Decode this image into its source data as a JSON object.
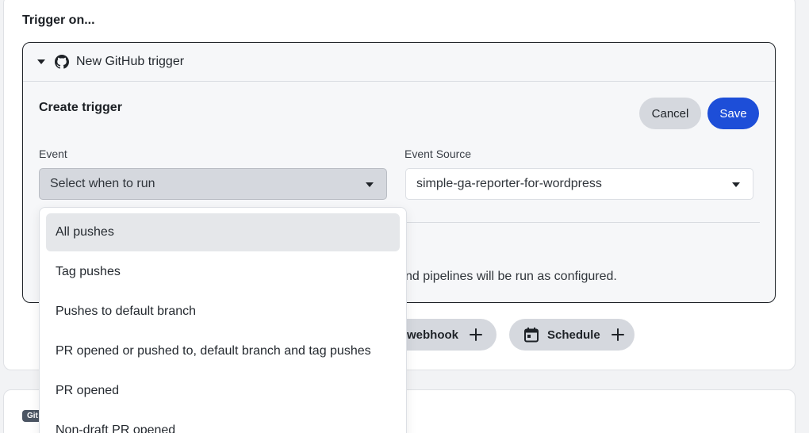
{
  "section": {
    "title": "Trigger on..."
  },
  "trigger": {
    "header_label": "New GitHub trigger",
    "create_title": "Create trigger",
    "cancel_label": "Cancel",
    "save_label": "Save",
    "event": {
      "label": "Event",
      "value": "Select when to run"
    },
    "event_source": {
      "label": "Event Source",
      "value": "simple-ga-reporter-for-wordpress"
    },
    "info_text": "nd pipelines will be run as configured."
  },
  "add_buttons": {
    "webhook_label": "webhook",
    "schedule_label": "Schedule"
  },
  "next_card": {
    "badge": "Git"
  },
  "dropdown": {
    "options": [
      {
        "label": "All pushes",
        "selected": true
      },
      {
        "label": "Tag pushes"
      },
      {
        "label": "Pushes to default branch"
      },
      {
        "label": "PR opened or pushed to, default branch and tag pushes"
      },
      {
        "label": "PR opened"
      },
      {
        "label": "Non-draft PR opened"
      }
    ]
  },
  "icons": {
    "github": "github-icon",
    "calendar": "calendar-icon",
    "plus": "plus-icon",
    "caret": "chevron-down-icon"
  },
  "colors": {
    "primary": "#1d4ed8",
    "pill_bg": "#d5d8de",
    "selected_option_bg": "#e5e7ea"
  }
}
